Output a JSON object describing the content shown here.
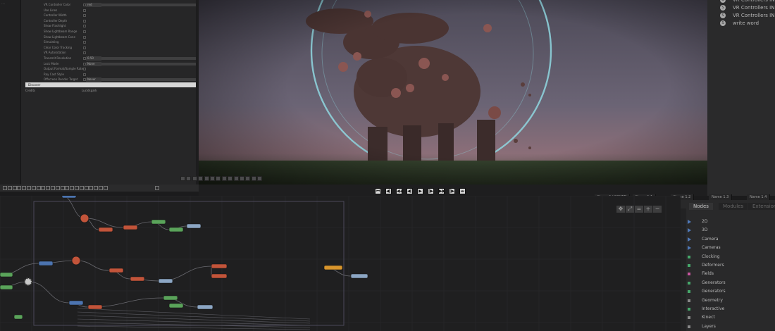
{
  "left_panel": {
    "tree_title": "…",
    "properties": [
      {
        "label": "VR Controller Color",
        "value": "red"
      },
      {
        "label": "Use Lines"
      },
      {
        "label": "Controller Width"
      },
      {
        "label": "Controller Depth"
      },
      {
        "label": "Show Flashlight"
      },
      {
        "label": "Show Lightbeam Range"
      },
      {
        "label": "Show Lightbeam Cone"
      },
      {
        "label": "Simulating"
      },
      {
        "label": "Clear Color Tracking"
      },
      {
        "label": "VR Autorotation"
      },
      {
        "label": "Transmit Resolution",
        "value": "0.50"
      },
      {
        "label": "Lock Mode",
        "value": "None"
      },
      {
        "label": "Output Format/Sample Rate"
      },
      {
        "label": "Ray Cast Style"
      },
      {
        "label": "Offscreen Render Target",
        "value": "Never"
      }
    ],
    "discover_label": "Discover",
    "credits_label": "Credits",
    "credits_value": "Lucidspark"
  },
  "right_top": {
    "items": [
      {
        "badge": "S",
        "text": "VR Controllers IN"
      },
      {
        "badge": "S",
        "text": "VR Controllers IN"
      },
      {
        "badge": "S",
        "text": "VR Controllers IN"
      },
      {
        "badge": "S",
        "text": "write word"
      }
    ]
  },
  "viewer_tabs": [
    "Name 1 LOCKED",
    "Name 1.1",
    "Name 1.2",
    "Name 1.3",
    "Name 1.4"
  ],
  "library": {
    "tabs": [
      "Nodes",
      "Modules",
      "Extensions"
    ],
    "items": [
      {
        "label": "2D",
        "kind": "tri",
        "color": "#4f79b8"
      },
      {
        "label": "3D",
        "kind": "tri",
        "color": "#4f79b8"
      },
      {
        "label": "Camera",
        "kind": "tri",
        "color": "#4f79b8"
      },
      {
        "label": "Cameras",
        "kind": "tri",
        "color": "#4f79b8"
      },
      {
        "label": "Clocking",
        "kind": "dot",
        "color": "#46a86a"
      },
      {
        "label": "Deformers",
        "kind": "dot",
        "color": "#46a86a"
      },
      {
        "label": "Fields",
        "kind": "dot",
        "color": "#c8559e"
      },
      {
        "label": "Generators",
        "kind": "dot",
        "color": "#46a86a"
      },
      {
        "label": "Generators",
        "kind": "dot",
        "color": "#46a86a"
      },
      {
        "label": "Geometry",
        "kind": "dot",
        "color": "#888888"
      },
      {
        "label": "Interactive",
        "kind": "dot",
        "color": "#46a86a"
      },
      {
        "label": "Kinect",
        "kind": "dot",
        "color": "#888888"
      },
      {
        "label": "Layers",
        "kind": "dot",
        "color": "#888888"
      }
    ]
  },
  "graph": {
    "nodes": [
      {
        "color": "#4c74b0"
      },
      {
        "color": "#c2543a"
      },
      {
        "color": "#c2543a"
      },
      {
        "color": "#c2543a"
      },
      {
        "color": "#5aa35a"
      },
      {
        "color": "#5aa35a"
      },
      {
        "color": "#8ca6c4"
      },
      {
        "color": "#4c74b0"
      },
      {
        "color": "#c2543a"
      },
      {
        "color": "#c2543a"
      },
      {
        "color": "#c2543a"
      },
      {
        "color": "#5aa35a"
      },
      {
        "color": "#8ca6c4"
      },
      {
        "color": "#c2543a"
      },
      {
        "color": "#c2543a"
      },
      {
        "color": "#d8952c"
      },
      {
        "color": "#8ca6c4"
      },
      {
        "color": "#5aa35a"
      },
      {
        "color": "#5aa35a"
      },
      {
        "color": "#8ca6c4"
      },
      {
        "color": "#4c74b0"
      },
      {
        "color": "#c2543a"
      },
      {
        "color": "#5aa35a"
      },
      {
        "color": "#5aa35a"
      },
      {
        "color": "#5aa35a"
      }
    ]
  },
  "accent_color": "#8fd7e0"
}
